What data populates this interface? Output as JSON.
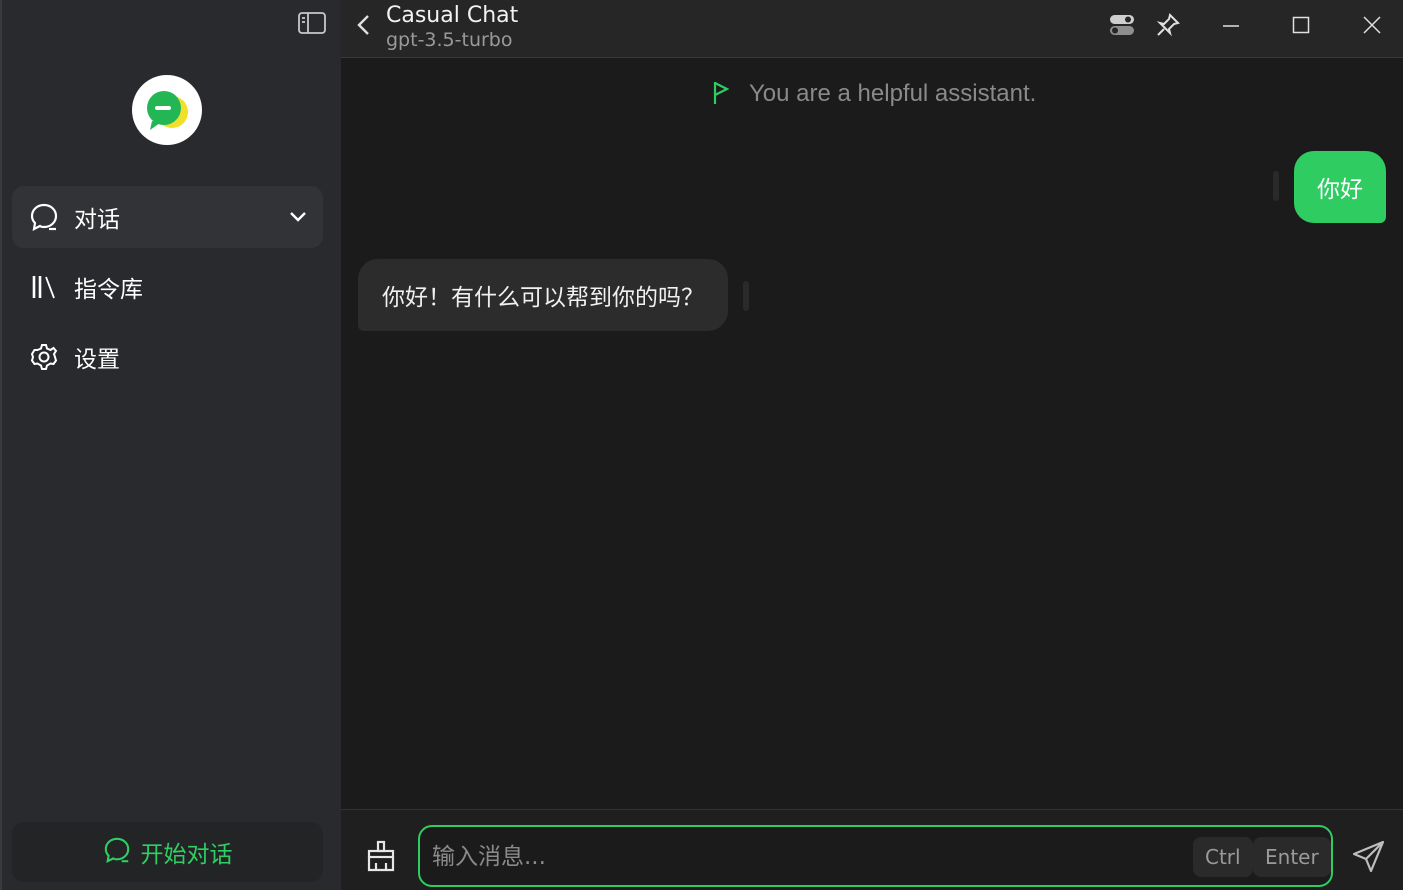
{
  "sidebar": {
    "nav": [
      {
        "label": "对话",
        "icon": "chat-bubble-icon",
        "active": true
      },
      {
        "label": "指令库",
        "icon": "library-icon",
        "active": false
      },
      {
        "label": "设置",
        "icon": "gear-icon",
        "active": false
      }
    ],
    "new_chat_label": "开始对话"
  },
  "header": {
    "title": "Casual Chat",
    "model": "gpt-3.5-turbo"
  },
  "conversation": {
    "system_prompt": "You are a helpful assistant.",
    "messages": [
      {
        "role": "user",
        "text": "你好"
      },
      {
        "role": "assistant",
        "text": "你好！有什么可以帮到你的吗？"
      }
    ]
  },
  "composer": {
    "placeholder": "输入消息...",
    "shortcut_ctrl": "Ctrl",
    "shortcut_enter": "Enter"
  },
  "colors": {
    "accent": "#2fcc62",
    "sidebar_bg": "#292a2d",
    "main_bg": "#1b1b1b"
  }
}
